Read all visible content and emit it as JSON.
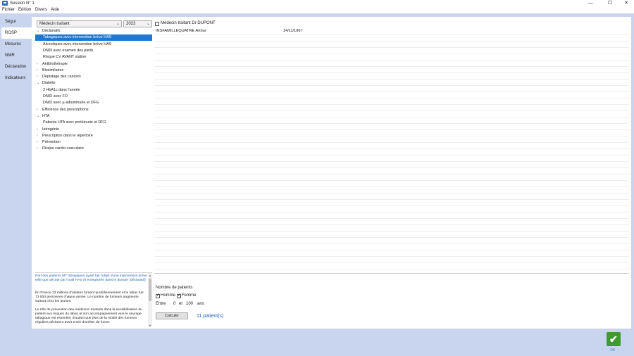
{
  "window": {
    "title": "Session N° 1",
    "min_glyph": "—",
    "max_glyph": "☐",
    "close_glyph": "✕"
  },
  "menu": [
    "Fichier",
    "Edition",
    "Divers",
    "Aide"
  ],
  "nav": [
    {
      "label": "Ségur",
      "active": false
    },
    {
      "label": "ROSP",
      "active": true
    },
    {
      "label": "Mesures",
      "active": false
    },
    {
      "label": "NMR",
      "active": false
    },
    {
      "label": "Déclaration",
      "active": false
    },
    {
      "label": "Indicateurs",
      "active": false
    }
  ],
  "filters": {
    "doctor_type": "Médecin traitant",
    "year": "2023",
    "doctor_checkbox_label": "Médecin traitant Dr DUPONT",
    "doctor_checkbox_checked": false
  },
  "tree": [
    {
      "label": "Déclaratifs",
      "level": 0,
      "expanded": true
    },
    {
      "label": "Tabagiques avec intervention brève HAS",
      "level": 1,
      "selected": true
    },
    {
      "label": "Alcooliques avec intervention brève HAS",
      "level": 1
    },
    {
      "label": "DNID avec examen des pieds",
      "level": 1
    },
    {
      "label": "Risque CV AVANT statine",
      "level": 1
    },
    {
      "label": "Antibiothérapie",
      "level": 0,
      "expanded": false
    },
    {
      "label": "Biosimilaires",
      "level": 0,
      "expanded": false
    },
    {
      "label": "Dépistage des cancers",
      "level": 0,
      "expanded": false
    },
    {
      "label": "Diabète",
      "level": 0,
      "expanded": true
    },
    {
      "label": "2 HbA1c dans l'année",
      "level": 1
    },
    {
      "label": "DNID avec FO",
      "level": 1
    },
    {
      "label": "DNID avec µ-albuminurie et DFG",
      "level": 1
    },
    {
      "label": "Efficience des prescriptions",
      "level": 0,
      "expanded": false
    },
    {
      "label": "HTA",
      "level": 0,
      "expanded": true
    },
    {
      "label": "Patients HTA avec protéinurie et DFG",
      "level": 1
    },
    {
      "label": "Iatrogénie",
      "level": 0,
      "expanded": false
    },
    {
      "label": "Prescription dans le répertoire",
      "level": 0,
      "expanded": false
    },
    {
      "label": "Prévention",
      "level": 0,
      "expanded": false
    },
    {
      "label": "Risque cardio-vasculaire",
      "level": 0,
      "expanded": false
    }
  ],
  "description": {
    "headline": "Part des patients MT tabagiques ayant fait l'objet d'une intervention brève telle que décrite par l'outil HAS et enregistrée dans le dossier (déclaratif)",
    "p1": "En France 13 millions d'adultes fument quotidiennement et le tabac tue 73 000 personnes chaque année. Le nombre de fumeurs augmente surtout chez les jeunes.",
    "p2": "Le rôle de prévention des médecins traitants dans la sensibilisation du patient aux risques du tabac et son accompagnement vers le sevrage tabagique est essentiel, d'autant que plus de la moitié des fumeurs réguliers déclarent avoir envie d'arrêter de fumer."
  },
  "patients": [
    {
      "name": "INSFAMILLEQUATRE Arthur",
      "birthdate": "14/11/1967"
    }
  ],
  "stats": {
    "count_label": "Nombre de patients :",
    "homme_label": "Homme",
    "homme_checked": true,
    "femme_label": "Femme",
    "femme_checked": true,
    "between_label": "Entre",
    "age_min": "0",
    "and_label": "et",
    "age_max": "100",
    "unit": "ans",
    "compute_label": "Calculer",
    "result": "11 patient(s)"
  },
  "ok_label": "OK"
}
